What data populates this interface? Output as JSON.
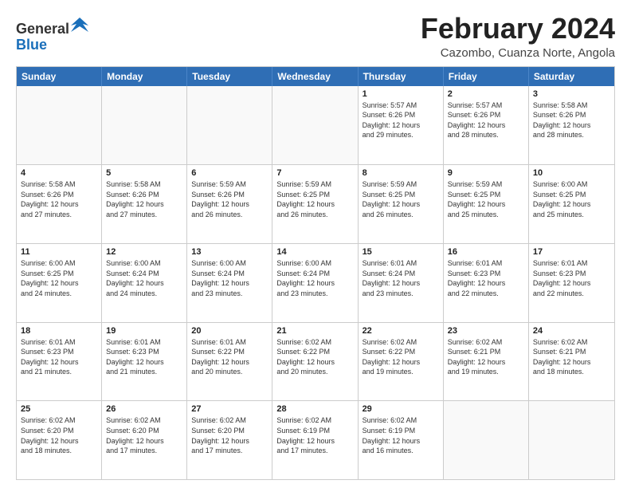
{
  "logo": {
    "general": "General",
    "blue": "Blue"
  },
  "title": "February 2024",
  "location": "Cazombo, Cuanza Norte, Angola",
  "days": [
    "Sunday",
    "Monday",
    "Tuesday",
    "Wednesday",
    "Thursday",
    "Friday",
    "Saturday"
  ],
  "weeks": [
    [
      {
        "day": "",
        "info": "",
        "empty": true
      },
      {
        "day": "",
        "info": "",
        "empty": true
      },
      {
        "day": "",
        "info": "",
        "empty": true
      },
      {
        "day": "",
        "info": "",
        "empty": true
      },
      {
        "day": "1",
        "info": "Sunrise: 5:57 AM\nSunset: 6:26 PM\nDaylight: 12 hours\nand 29 minutes."
      },
      {
        "day": "2",
        "info": "Sunrise: 5:57 AM\nSunset: 6:26 PM\nDaylight: 12 hours\nand 28 minutes."
      },
      {
        "day": "3",
        "info": "Sunrise: 5:58 AM\nSunset: 6:26 PM\nDaylight: 12 hours\nand 28 minutes."
      }
    ],
    [
      {
        "day": "4",
        "info": "Sunrise: 5:58 AM\nSunset: 6:26 PM\nDaylight: 12 hours\nand 27 minutes."
      },
      {
        "day": "5",
        "info": "Sunrise: 5:58 AM\nSunset: 6:26 PM\nDaylight: 12 hours\nand 27 minutes."
      },
      {
        "day": "6",
        "info": "Sunrise: 5:59 AM\nSunset: 6:26 PM\nDaylight: 12 hours\nand 26 minutes."
      },
      {
        "day": "7",
        "info": "Sunrise: 5:59 AM\nSunset: 6:25 PM\nDaylight: 12 hours\nand 26 minutes."
      },
      {
        "day": "8",
        "info": "Sunrise: 5:59 AM\nSunset: 6:25 PM\nDaylight: 12 hours\nand 26 minutes."
      },
      {
        "day": "9",
        "info": "Sunrise: 5:59 AM\nSunset: 6:25 PM\nDaylight: 12 hours\nand 25 minutes."
      },
      {
        "day": "10",
        "info": "Sunrise: 6:00 AM\nSunset: 6:25 PM\nDaylight: 12 hours\nand 25 minutes."
      }
    ],
    [
      {
        "day": "11",
        "info": "Sunrise: 6:00 AM\nSunset: 6:25 PM\nDaylight: 12 hours\nand 24 minutes."
      },
      {
        "day": "12",
        "info": "Sunrise: 6:00 AM\nSunset: 6:24 PM\nDaylight: 12 hours\nand 24 minutes."
      },
      {
        "day": "13",
        "info": "Sunrise: 6:00 AM\nSunset: 6:24 PM\nDaylight: 12 hours\nand 23 minutes."
      },
      {
        "day": "14",
        "info": "Sunrise: 6:00 AM\nSunset: 6:24 PM\nDaylight: 12 hours\nand 23 minutes."
      },
      {
        "day": "15",
        "info": "Sunrise: 6:01 AM\nSunset: 6:24 PM\nDaylight: 12 hours\nand 23 minutes."
      },
      {
        "day": "16",
        "info": "Sunrise: 6:01 AM\nSunset: 6:23 PM\nDaylight: 12 hours\nand 22 minutes."
      },
      {
        "day": "17",
        "info": "Sunrise: 6:01 AM\nSunset: 6:23 PM\nDaylight: 12 hours\nand 22 minutes."
      }
    ],
    [
      {
        "day": "18",
        "info": "Sunrise: 6:01 AM\nSunset: 6:23 PM\nDaylight: 12 hours\nand 21 minutes."
      },
      {
        "day": "19",
        "info": "Sunrise: 6:01 AM\nSunset: 6:23 PM\nDaylight: 12 hours\nand 21 minutes."
      },
      {
        "day": "20",
        "info": "Sunrise: 6:01 AM\nSunset: 6:22 PM\nDaylight: 12 hours\nand 20 minutes."
      },
      {
        "day": "21",
        "info": "Sunrise: 6:02 AM\nSunset: 6:22 PM\nDaylight: 12 hours\nand 20 minutes."
      },
      {
        "day": "22",
        "info": "Sunrise: 6:02 AM\nSunset: 6:22 PM\nDaylight: 12 hours\nand 19 minutes."
      },
      {
        "day": "23",
        "info": "Sunrise: 6:02 AM\nSunset: 6:21 PM\nDaylight: 12 hours\nand 19 minutes."
      },
      {
        "day": "24",
        "info": "Sunrise: 6:02 AM\nSunset: 6:21 PM\nDaylight: 12 hours\nand 18 minutes."
      }
    ],
    [
      {
        "day": "25",
        "info": "Sunrise: 6:02 AM\nSunset: 6:20 PM\nDaylight: 12 hours\nand 18 minutes."
      },
      {
        "day": "26",
        "info": "Sunrise: 6:02 AM\nSunset: 6:20 PM\nDaylight: 12 hours\nand 17 minutes."
      },
      {
        "day": "27",
        "info": "Sunrise: 6:02 AM\nSunset: 6:20 PM\nDaylight: 12 hours\nand 17 minutes."
      },
      {
        "day": "28",
        "info": "Sunrise: 6:02 AM\nSunset: 6:19 PM\nDaylight: 12 hours\nand 17 minutes."
      },
      {
        "day": "29",
        "info": "Sunrise: 6:02 AM\nSunset: 6:19 PM\nDaylight: 12 hours\nand 16 minutes."
      },
      {
        "day": "",
        "info": "",
        "empty": true
      },
      {
        "day": "",
        "info": "",
        "empty": true
      }
    ]
  ]
}
